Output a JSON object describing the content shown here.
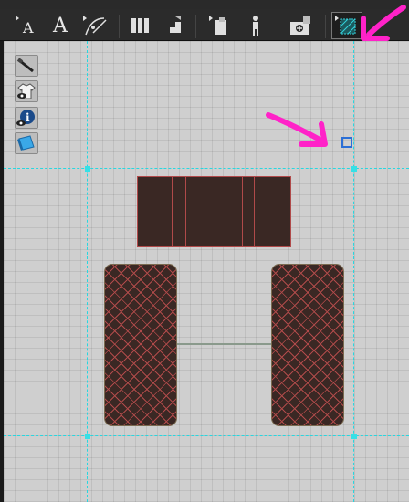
{
  "toolbar": {
    "tools": [
      {
        "name": "text-tool-small",
        "label": "A"
      },
      {
        "name": "text-tool",
        "label": "A"
      },
      {
        "name": "pen-curve-tool",
        "label": ""
      },
      {
        "name": "columns-tool",
        "label": ""
      },
      {
        "name": "stairs-tool",
        "label": ""
      },
      {
        "name": "object-tool",
        "label": ""
      },
      {
        "name": "figure-tool",
        "label": ""
      },
      {
        "name": "add-object-tool",
        "label": ""
      },
      {
        "name": "floor-pattern-tool",
        "label": ""
      }
    ],
    "active_tool": "floor-pattern-tool"
  },
  "side_panel": {
    "buttons": [
      "brush-icon",
      "shirt-eye-icon",
      "info-eye-icon",
      "book-icon"
    ]
  },
  "annotation_color": "#ff22c8",
  "guide_color": "#28d7e0",
  "furniture_colors": {
    "fill": "#3a2824",
    "stroke": "#b04a4a"
  }
}
